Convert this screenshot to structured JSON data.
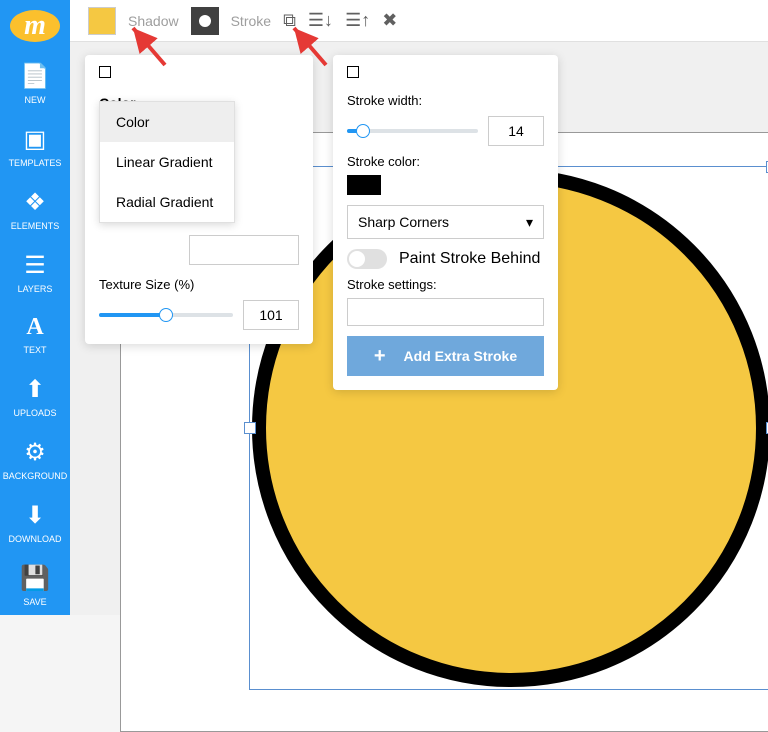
{
  "sidebar": {
    "items": [
      {
        "label": "NEW",
        "icon": "📄"
      },
      {
        "label": "TEMPLATES",
        "icon": "▣"
      },
      {
        "label": "ELEMENTS",
        "icon": "❖"
      },
      {
        "label": "LAYERS",
        "icon": "☰"
      },
      {
        "label": "TEXT",
        "icon": "A"
      },
      {
        "label": "UPLOADS",
        "icon": "⬆"
      },
      {
        "label": "BACKGROUND",
        "icon": "⚙"
      },
      {
        "label": "DOWNLOAD",
        "icon": "⬇"
      },
      {
        "label": "SAVE",
        "icon": "💾"
      }
    ]
  },
  "topbar": {
    "shadow_label": "Shadow",
    "stroke_label": "Stroke"
  },
  "color_panel": {
    "header": "Color",
    "dropdown": {
      "items": [
        "Color",
        "Linear Gradient",
        "Radial Gradient"
      ],
      "selected": "Color"
    },
    "texture_label": "Texture Size (%)",
    "texture_value": "101"
  },
  "stroke_panel": {
    "width_label": "Stroke width:",
    "width_value": "14",
    "color_label": "Stroke color:",
    "color_value": "#000000",
    "corners_value": "Sharp Corners",
    "paint_behind_label": "Paint Stroke Behind",
    "settings_label": "Stroke settings:",
    "add_button": "Add Extra Stroke"
  },
  "canvas": {
    "shape_fill": "#f5c842",
    "shape_stroke": "#000000",
    "shape_stroke_width": 14
  }
}
